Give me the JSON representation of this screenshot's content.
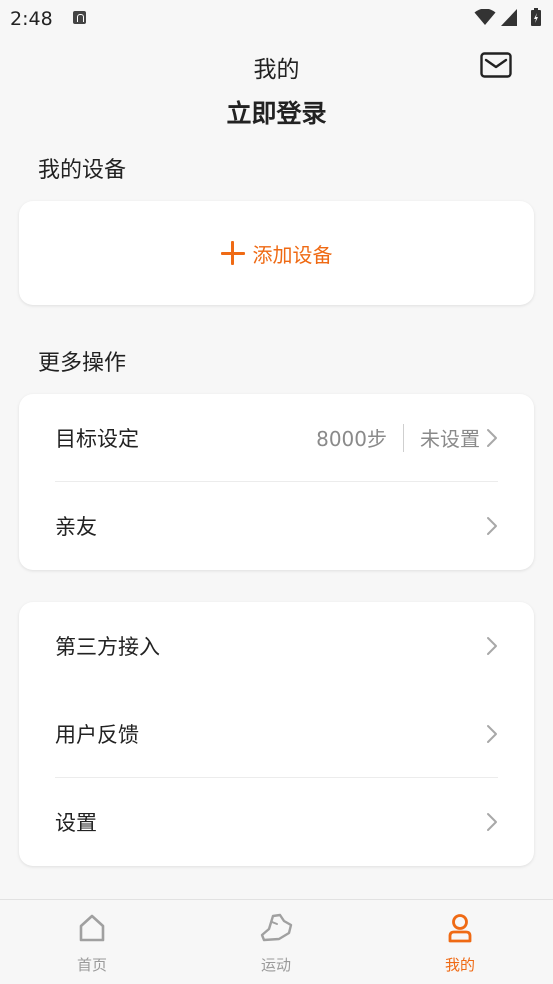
{
  "status_bar": {
    "time": "2:48"
  },
  "header": {
    "title": "我的",
    "login": "立即登录"
  },
  "my_devices": {
    "title": "我的设备",
    "add_label": "添加设备"
  },
  "more_ops": {
    "title": "更多操作",
    "goal": {
      "label": "目标设定",
      "value": "8000步",
      "status": "未设置"
    },
    "friends": {
      "label": "亲友"
    }
  },
  "misc_menu": {
    "third_party": "第三方接入",
    "feedback": "用户反馈",
    "settings": "设置"
  },
  "tabs": [
    {
      "label": "首页",
      "icon": "home-icon"
    },
    {
      "label": "运动",
      "icon": "shoe-icon"
    },
    {
      "label": "我的",
      "icon": "person-icon"
    }
  ],
  "colors": {
    "accent": "#ef6a14",
    "background": "#f7f7f7",
    "card": "#ffffff",
    "muted": "#8a8a8a"
  }
}
